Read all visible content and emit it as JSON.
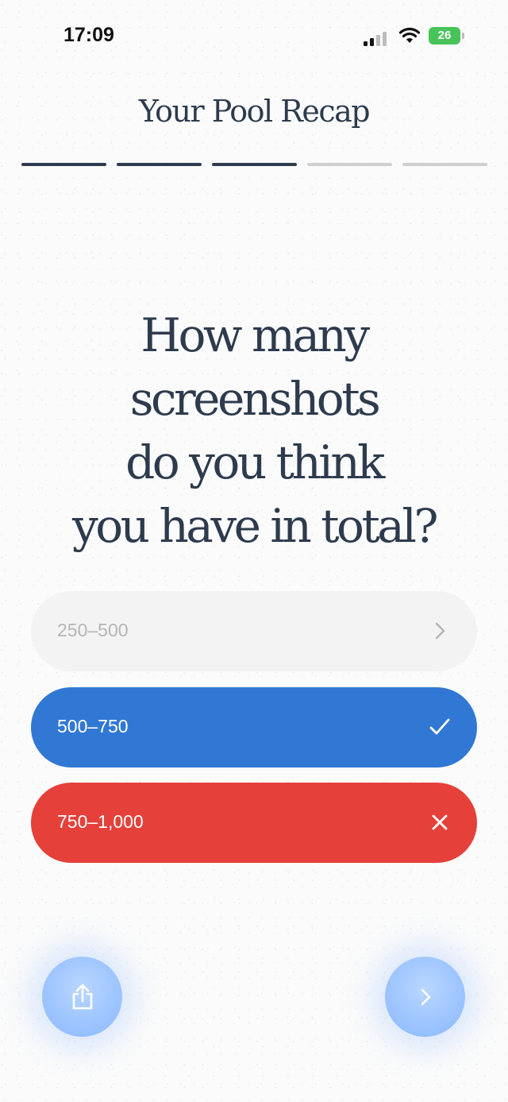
{
  "status_bar": {
    "time": "17:09",
    "battery": "26"
  },
  "header": {
    "title": "Your Pool Recap",
    "progress_total": 5,
    "progress_current": 3
  },
  "question": {
    "lines": [
      "How many",
      "screenshots",
      "do you think",
      "you have in total?"
    ]
  },
  "options": [
    {
      "label": "250–500",
      "state": "neutral",
      "icon": "chevron-right-icon"
    },
    {
      "label": "500–750",
      "state": "correct",
      "icon": "checkmark-icon"
    },
    {
      "label": "750–1,000",
      "state": "wrong",
      "icon": "close-icon"
    }
  ],
  "colors": {
    "text_dark": "#2e3b4e",
    "correct": "#3178d4",
    "wrong": "#e5403a",
    "neutral_bg": "#f3f3f3",
    "button_blue": "#9cc4ff"
  },
  "buttons": {
    "share_icon": "share-icon",
    "next_icon": "chevron-right-icon"
  }
}
